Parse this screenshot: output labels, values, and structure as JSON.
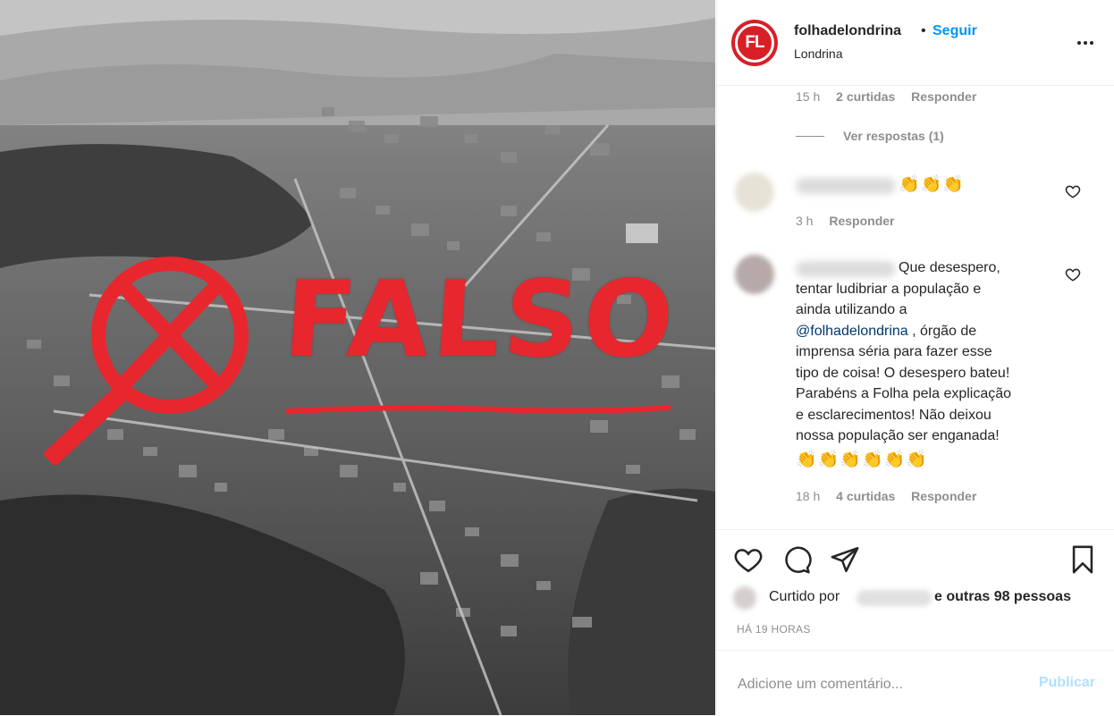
{
  "post": {
    "username": "folhadelondrina",
    "follow_label": "Seguir",
    "location": "Londrina",
    "avatar_text": "FL"
  },
  "image": {
    "overlay_text": "FALSO",
    "description_icon": "prohibited-magnifier-icon"
  },
  "comments": {
    "first": {
      "time": "15 h",
      "likes": "2 curtidas",
      "reply_label": "Responder",
      "view_replies": "Ver respostas (1)"
    },
    "second": {
      "emojis": "👏👏👏",
      "time": "3 h",
      "reply_label": "Responder"
    },
    "third": {
      "text_line1": "Que desespero,",
      "text_before_mention": "tentar ludibriar a população e\nainda utilizando a\n",
      "mention": "@folhadelondrina",
      "text_after_mention": " , órgão de\nimprensa séria para fazer esse\ntipo de coisa! O desespero bateu!\nParabéns a Folha pela explicação\ne esclarecimentos! Não deixou\nnossa população ser enganada!",
      "emojis": "👏👏👏👏👏👏",
      "time": "18 h",
      "likes": "4 curtidas",
      "reply_label": "Responder"
    }
  },
  "likes": {
    "prefix": "Curtido por",
    "rest": "e outras 98 pessoas"
  },
  "time_ago": "HÁ 19 HORAS",
  "composer": {
    "placeholder": "Adicione um comentário...",
    "publish_label": "Publicar"
  },
  "colors": {
    "brand_red": "#d81f26",
    "link_blue": "#0095f6",
    "falso_red": "#e8262e"
  }
}
